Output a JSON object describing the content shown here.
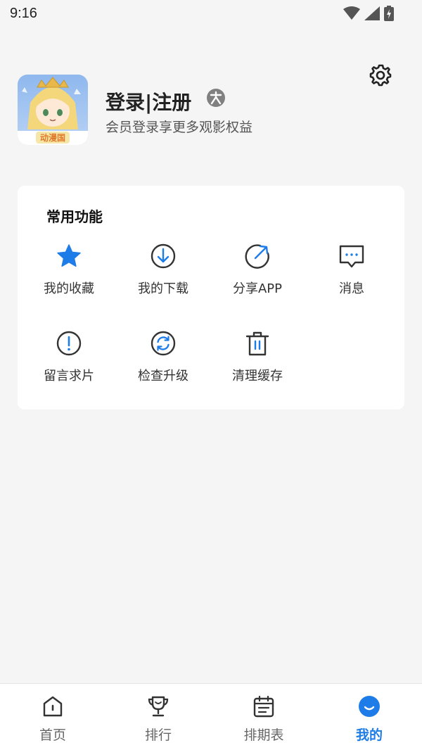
{
  "status_bar": {
    "time": "9:16"
  },
  "profile": {
    "title": "登录|注册",
    "subtitle": "会员登录享更多观影权益",
    "avatar_text": "动漫国",
    "badge_icon": "level-badge-icon"
  },
  "functions": {
    "title": "常用功能",
    "items": [
      {
        "label": "我的收藏",
        "icon": "star-icon"
      },
      {
        "label": "我的下载",
        "icon": "download-icon"
      },
      {
        "label": "分享APP",
        "icon": "share-icon"
      },
      {
        "label": "消息",
        "icon": "message-icon"
      },
      {
        "label": "留言求片",
        "icon": "exclamation-icon"
      },
      {
        "label": "检查升级",
        "icon": "refresh-icon"
      },
      {
        "label": "清理缓存",
        "icon": "trash-icon"
      }
    ]
  },
  "bottom_nav": {
    "items": [
      {
        "label": "首页",
        "icon": "home-icon"
      },
      {
        "label": "排行",
        "icon": "trophy-icon"
      },
      {
        "label": "排期表",
        "icon": "calendar-icon"
      },
      {
        "label": "我的",
        "icon": "smile-icon"
      }
    ],
    "active_index": 3
  },
  "colors": {
    "accent": "#1e7ce8",
    "background": "#f5f5f5",
    "icon_dark": "#333333"
  }
}
